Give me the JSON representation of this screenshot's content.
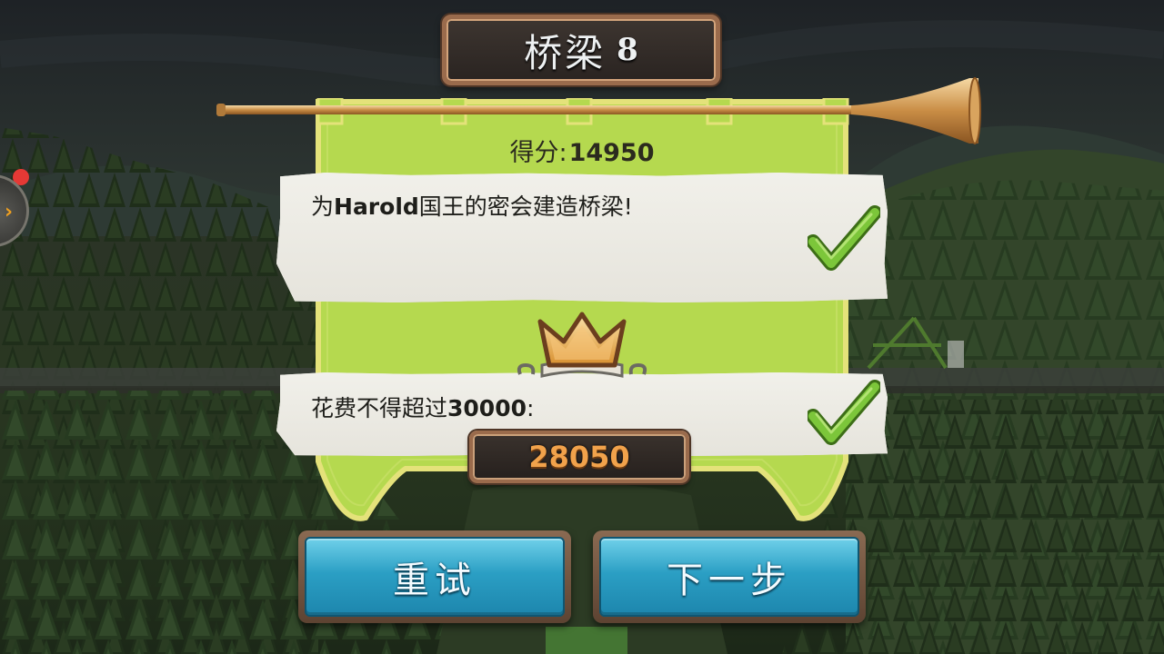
{
  "title": {
    "text": "桥梁",
    "level": "8"
  },
  "score": {
    "label": "得分:",
    "value": "14950"
  },
  "objectives": [
    {
      "prefix": "为",
      "highlight": "Harold",
      "suffix": "国王的密会建造桥梁!",
      "completed": true,
      "icon": "checkmark-icon"
    },
    {
      "prefix": "花费不得超过",
      "highlight": "30000",
      "suffix": ":",
      "completed": true,
      "icon": "checkmark-icon"
    }
  ],
  "cost": {
    "value": "28050"
  },
  "buttons": {
    "retry": "重试",
    "next": "下一步"
  },
  "side_button": {
    "icon": "chevron-right-icon",
    "chevron": "›",
    "has_notification": true
  },
  "colors": {
    "banner": "#b5d94f",
    "banner_border": "#e4e27a",
    "button": "#2b9fc4",
    "cost_text": "#f1a24b",
    "check": "#7cc63a"
  }
}
